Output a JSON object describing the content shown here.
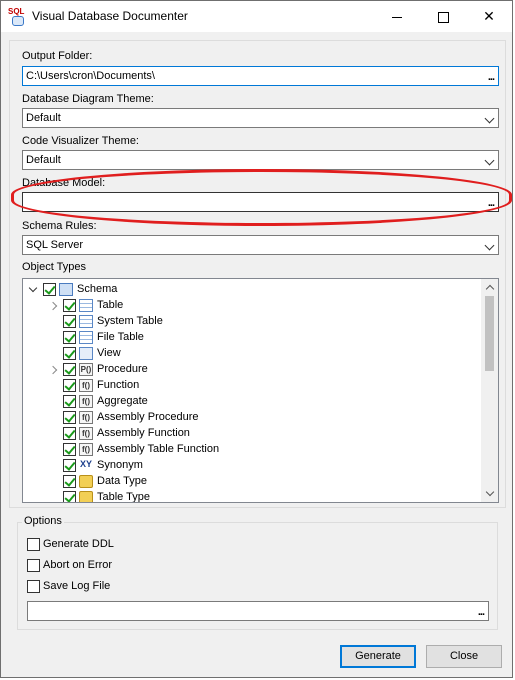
{
  "window": {
    "title": "Visual Database Documenter",
    "app_icon_text": "SQL",
    "controls": {
      "minimize": "minimize",
      "maximize": "maximize",
      "close": "✕"
    }
  },
  "fields": {
    "output_folder": {
      "label": "Output Folder:",
      "value": "C:\\Users\\cron\\Documents\\",
      "browse": "..."
    },
    "diagram_theme": {
      "label": "Database Diagram Theme:",
      "value": "Default"
    },
    "code_theme": {
      "label": "Code Visualizer Theme:",
      "value": "Default"
    },
    "database_model": {
      "label": "Database Model:",
      "value": "",
      "browse": "..."
    },
    "schema_rules": {
      "label": "Schema Rules:",
      "value": "SQL Server"
    }
  },
  "object_types": {
    "title": "Object Types",
    "items": [
      {
        "label": "Schema",
        "checked": true,
        "expander": "expanded",
        "icon": "schema-icon",
        "level": 0
      },
      {
        "label": "Table",
        "checked": true,
        "expander": "collapsed",
        "icon": "table-icon",
        "level": 1
      },
      {
        "label": "System Table",
        "checked": true,
        "expander": "",
        "icon": "table-icon",
        "level": 1
      },
      {
        "label": "File Table",
        "checked": true,
        "expander": "",
        "icon": "table-icon",
        "level": 1
      },
      {
        "label": "View",
        "checked": true,
        "expander": "",
        "icon": "view-icon",
        "level": 1
      },
      {
        "label": "Procedure",
        "checked": true,
        "expander": "collapsed",
        "icon": "procedure-icon",
        "level": 1,
        "glyph": "P()"
      },
      {
        "label": "Function",
        "checked": true,
        "expander": "",
        "icon": "function-icon",
        "level": 1,
        "glyph": "f()"
      },
      {
        "label": "Aggregate",
        "checked": true,
        "expander": "",
        "icon": "function-icon",
        "level": 1,
        "glyph": "f()"
      },
      {
        "label": "Assembly Procedure",
        "checked": true,
        "expander": "",
        "icon": "function-icon",
        "level": 1,
        "glyph": "f()"
      },
      {
        "label": "Assembly Function",
        "checked": true,
        "expander": "",
        "icon": "function-icon",
        "level": 1,
        "glyph": "f()"
      },
      {
        "label": "Assembly Table Function",
        "checked": true,
        "expander": "",
        "icon": "function-icon",
        "level": 1,
        "glyph": "f()"
      },
      {
        "label": "Synonym",
        "checked": true,
        "expander": "",
        "icon": "synonym-icon",
        "level": 1,
        "glyph": "XY"
      },
      {
        "label": "Data Type",
        "checked": true,
        "expander": "",
        "icon": "type-icon",
        "level": 1
      },
      {
        "label": "Table Type",
        "checked": true,
        "expander": "",
        "icon": "type-icon",
        "level": 1
      }
    ]
  },
  "options": {
    "title": "Options",
    "generate_ddl": {
      "label": "Generate DDL",
      "checked": false
    },
    "abort_on_error": {
      "label": "Abort on Error",
      "checked": false
    },
    "save_log_file": {
      "label": "Save Log File",
      "checked": false
    },
    "log_path": {
      "value": "",
      "browse": "..."
    }
  },
  "buttons": {
    "generate": "Generate",
    "close": "Close"
  },
  "colors": {
    "highlight": "#e01e1e",
    "accent": "#0078d7",
    "check": "#1a9a1a"
  }
}
